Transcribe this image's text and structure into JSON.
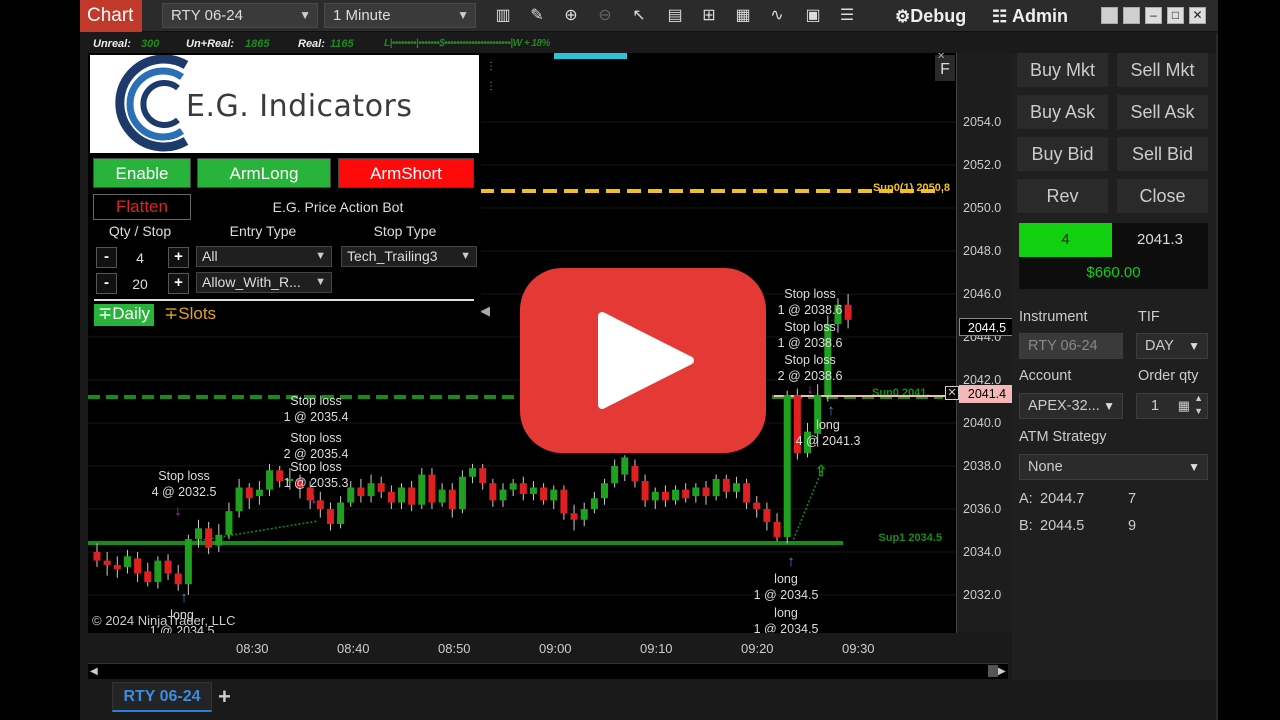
{
  "toolbar": {
    "title": "Chart",
    "instrument": "RTY 06-24",
    "interval": "1 Minute",
    "debug": "Debug",
    "admin": "Admin",
    "icons": [
      "bar-chart-icon",
      "draw-icon",
      "zoom-in-icon",
      "zoom-out-icon",
      "pointer-icon",
      "data-box-icon",
      "properties-icon",
      "strategies-icon",
      "indicators-icon",
      "templates-icon",
      "list-icon"
    ]
  },
  "statusbar": {
    "unreal_label": "Unreal:",
    "unreal_value": "300",
    "unreal_plus_label": "Un+Real:",
    "unreal_plus_value": "1865",
    "real_label": "Real:",
    "real_value": "1165",
    "gauge": "L|••••••••|•••••••$••••••••••••••••••••••|W + 18%"
  },
  "chart": {
    "copyright": "© 2024 NinjaTrader, LLC",
    "sup0_label": "Sup0(1) 2050.8",
    "sup0b_label": "Sup0 2041.",
    "sup1_label": "Sup1 2034.5",
    "f_button": "F",
    "annotations": [
      {
        "l1": "Stop loss",
        "l2": "4 @ 2032.5"
      },
      {
        "l1": "Stop loss",
        "l2": "1 @ 2035.4"
      },
      {
        "l1": "Stop loss",
        "l2": "2 @ 2035.4"
      },
      {
        "l1": "Stop loss",
        "l2": "1 @ 2035.3"
      },
      {
        "l1": "Stop loss",
        "l2": "1 @ 2038.6"
      },
      {
        "l1": "Stop loss",
        "l2": "1 @ 2038.6"
      },
      {
        "l1": "Stop loss",
        "l2": "2 @ 2038.6"
      },
      {
        "l1": "long",
        "l2": "1 @ 2034.5"
      },
      {
        "l1": "long",
        "l2": "1 @ 2034.5"
      },
      {
        "l1": "long",
        "l2": "1 @ 2034.5"
      },
      {
        "l1": "long",
        "l2": "4 @ 2041.3"
      }
    ]
  },
  "price_axis": {
    "ticks": [
      "2054.0",
      "2052.0",
      "2050.0",
      "2048.0",
      "2046.0",
      "2044.0",
      "2042.0",
      "2040.0",
      "2038.0",
      "2036.0",
      "2034.0",
      "2032.0"
    ],
    "last_price": "2044.5",
    "entry_price": "2041.4"
  },
  "time_axis": {
    "ticks": [
      "08:30",
      "08:40",
      "08:50",
      "09:00",
      "09:10",
      "09:20",
      "09:30"
    ]
  },
  "indicator_panel": {
    "logo_text": "E.G. Indicators",
    "enable": "Enable",
    "arm_long": "ArmLong",
    "arm_short": "ArmShort",
    "flatten": "Flatten",
    "bot_name": "E.G. Price Action Bot",
    "qty_stop_label": "Qty / Stop",
    "entry_type_label": "Entry Type",
    "stop_type_label": "Stop Type",
    "qty_value": "4",
    "stop_value": "20",
    "entry_type": "All",
    "entry_type_2": "Allow_With_R...",
    "stop_type": "Tech_Trailing3",
    "daily": "∓Daily",
    "slots": "∓Slots"
  },
  "order_panel": {
    "buy_mkt": "Buy Mkt",
    "sell_mkt": "Sell Mkt",
    "buy_ask": "Buy Ask",
    "sell_ask": "Sell Ask",
    "buy_bid": "Buy Bid",
    "sell_bid": "Sell Bid",
    "rev": "Rev",
    "close": "Close",
    "position_qty": "4",
    "position_price": "2041.3",
    "pnl": "$660.00",
    "instrument_label": "Instrument",
    "tif_label": "TIF",
    "instrument": "RTY 06-24",
    "tif": "DAY",
    "account_label": "Account",
    "order_qty_label": "Order qty",
    "account": "APEX-32...",
    "order_qty": "1",
    "atm_label": "ATM Strategy",
    "atm": "None",
    "ask_label": "A:",
    "ask_price": "2044.7",
    "ask_size": "7",
    "bid_label": "B:",
    "bid_price": "2044.5",
    "bid_size": "9"
  },
  "tabs": [
    {
      "label": "RTY 06-24"
    }
  ],
  "colors": {
    "accent_red": "#c0392b",
    "up_candle": "#1fa01f",
    "down_candle": "#e02020",
    "sup0": "#f0c020",
    "sup_green": "#1a8a1a",
    "play_red": "#e53935"
  }
}
